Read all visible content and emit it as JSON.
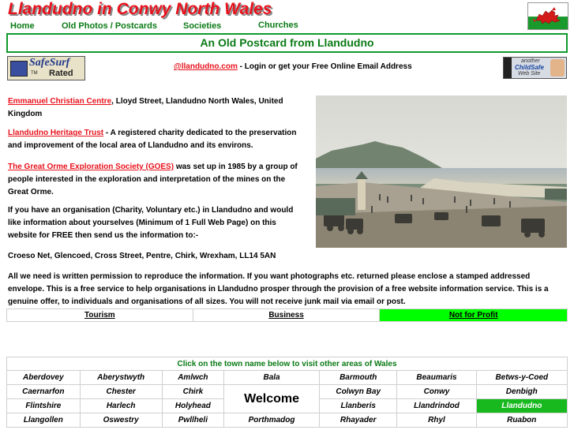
{
  "header": {
    "title": "Llandudno in Conwy North Wales",
    "flag_icon": "welsh-dragon-flag-icon"
  },
  "nav": {
    "home": "Home",
    "old_photos": "Old Photos / Postcards",
    "societies": "Societies",
    "churches": "Churches"
  },
  "banner": "An Old Postcard from Llandudno",
  "badges": {
    "safesurf_logo": "SafeSurf",
    "safesurf_tm": "TM",
    "safesurf_rated": "Rated",
    "childsafe_top": "another",
    "childsafe_mid": "ChildSafe",
    "childsafe_bottom": "Web Site"
  },
  "email": {
    "link": "@llandudno.com",
    "text": " - Login or get your Free Online Email Address"
  },
  "content": {
    "p1_link": "Emmanuel Christian Centre",
    "p1_text": ", Lloyd Street, Llandudno North Wales, United Kingdom",
    "p2_link": "Llandudno Heritage Trust",
    "p2_text": " - A registered charity dedicated to the preservation and improvement of the local area of Llandudno and its environs.",
    "p3_link": "The Great Orme Exploration Society (GOES)",
    "p3_text": " was set up in 1985 by a group of people interested in the exploration and interpretation of the mines on the Great Orme.",
    "p4": "If you have an  organisation (Charity, Voluntary etc.)  in Llandudno and would like information about yourselves (Minimum of 1 Full Web Page) on this website for FREE then send us the information to:-",
    "p5": "Croeso Net, Glencoed, Cross Street, Pentre, Chirk, Wrexham, LL14 5AN",
    "p6": "All we need is written permission to reproduce the information. If you want photographs etc. returned please enclose a stamped addressed envelope. This is a free service to help  organisations in Llandudno prosper through the provision of a free website information service. This is a genuine offer, to individuals and organisations of all sizes. You will not receive junk mail via email or post."
  },
  "linkbar": [
    "Tourism",
    "Business",
    "Not for Profit"
  ],
  "linkbar_active": "Not for Profit",
  "towns": {
    "heading": "Click on the town name below to visit other areas of Wales",
    "welcome": "Welcome",
    "active": "Llandudno",
    "rows": [
      [
        "Aberdovey",
        "Aberystwyth",
        "Amlwch",
        "Bala",
        "Barmouth",
        "Beaumaris",
        "Betws-y-Coed"
      ],
      [
        "Caernarfon",
        "Chester",
        "Chirk",
        "",
        "Colwyn Bay",
        "Conwy",
        "Denbigh"
      ],
      [
        "Flintshire",
        "Harlech",
        "Holyhead",
        "",
        "Llanberis",
        "Llandrindod",
        "Llandudno"
      ],
      [
        "Llangollen",
        "Oswestry",
        "Pwllheli",
        "Porthmadog",
        "Rhayader",
        "Rhyl",
        "Ruabon"
      ]
    ]
  },
  "colors": {
    "title_red": "#e8121c",
    "nav_green": "#0a7a15",
    "active_green": "#00ff00"
  }
}
